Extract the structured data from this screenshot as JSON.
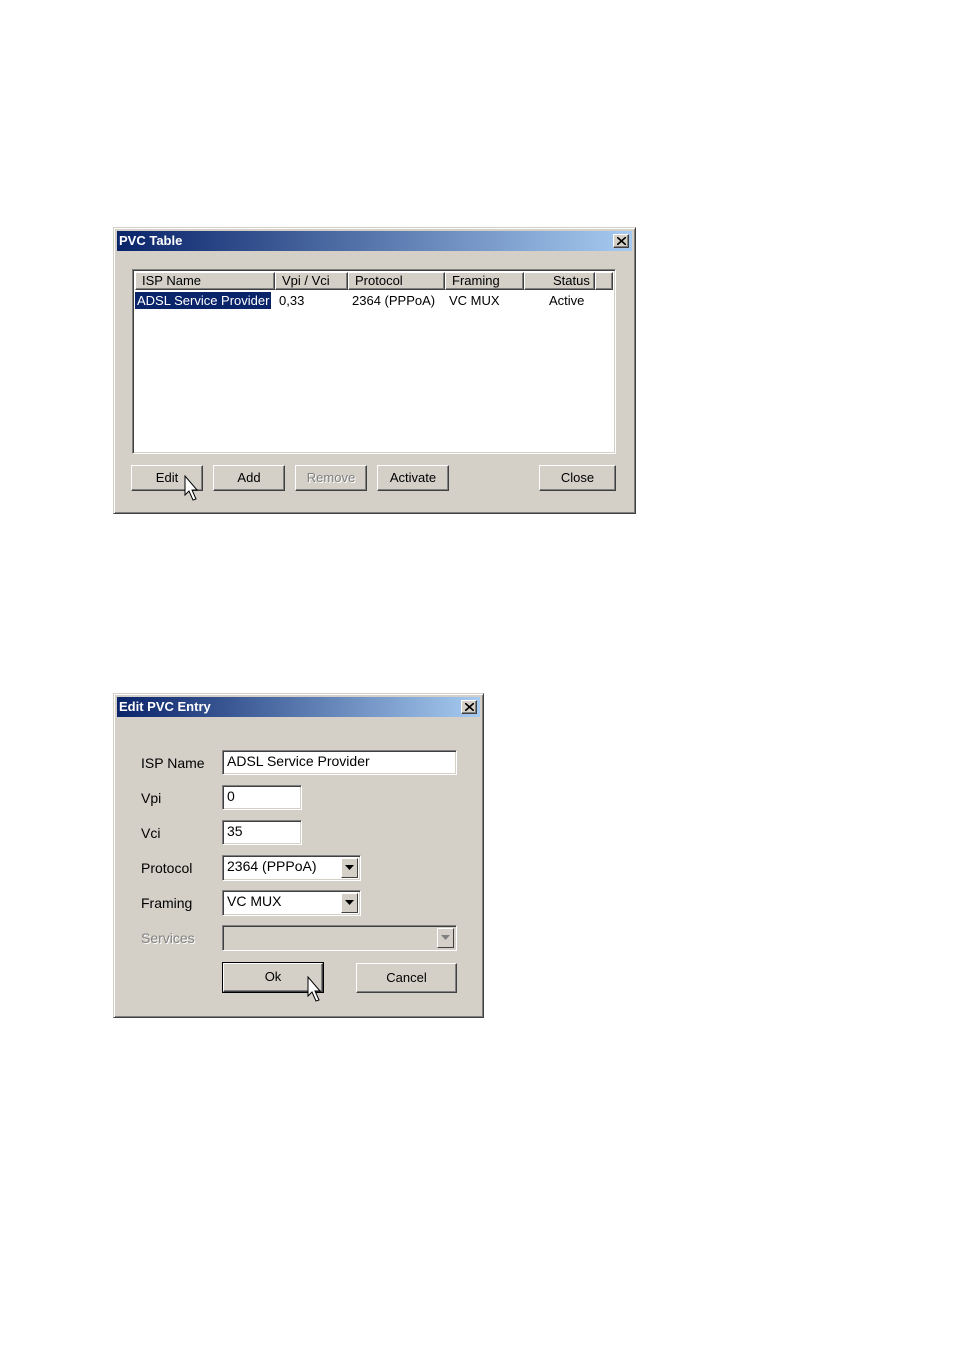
{
  "pvc_table": {
    "title": "PVC Table",
    "columns": [
      "ISP Name",
      "Vpi / Vci",
      "Protocol",
      "Framing",
      "Status"
    ],
    "rows": [
      [
        "ADSL Service Provider",
        "0,33",
        "2364 (PPPoA)",
        "VC MUX",
        "Active"
      ]
    ],
    "buttons": {
      "edit": "Edit",
      "add": "Add",
      "remove": "Remove",
      "activate": "Activate",
      "close": "Close"
    }
  },
  "edit_pvc": {
    "title": "Edit PVC Entry",
    "labels": {
      "isp_name": "ISP Name",
      "vpi": "Vpi",
      "vci": "Vci",
      "protocol": "Protocol",
      "framing": "Framing",
      "services": "Services"
    },
    "values": {
      "isp_name": "ADSL Service Provider",
      "vpi": "0",
      "vci": "35",
      "protocol": "2364 (PPPoA)",
      "framing": "VC MUX",
      "services": ""
    },
    "buttons": {
      "ok": "Ok",
      "cancel": "Cancel"
    }
  },
  "icons": {
    "close": "close-icon",
    "dropdown": "chevron-down-icon",
    "cursor": "mouse-pointer-icon"
  },
  "colors": {
    "titlebar_start": "#0a246a",
    "titlebar_end": "#a6caf0",
    "dialog_face": "#d4d0c8",
    "selection": "#0a246a"
  }
}
